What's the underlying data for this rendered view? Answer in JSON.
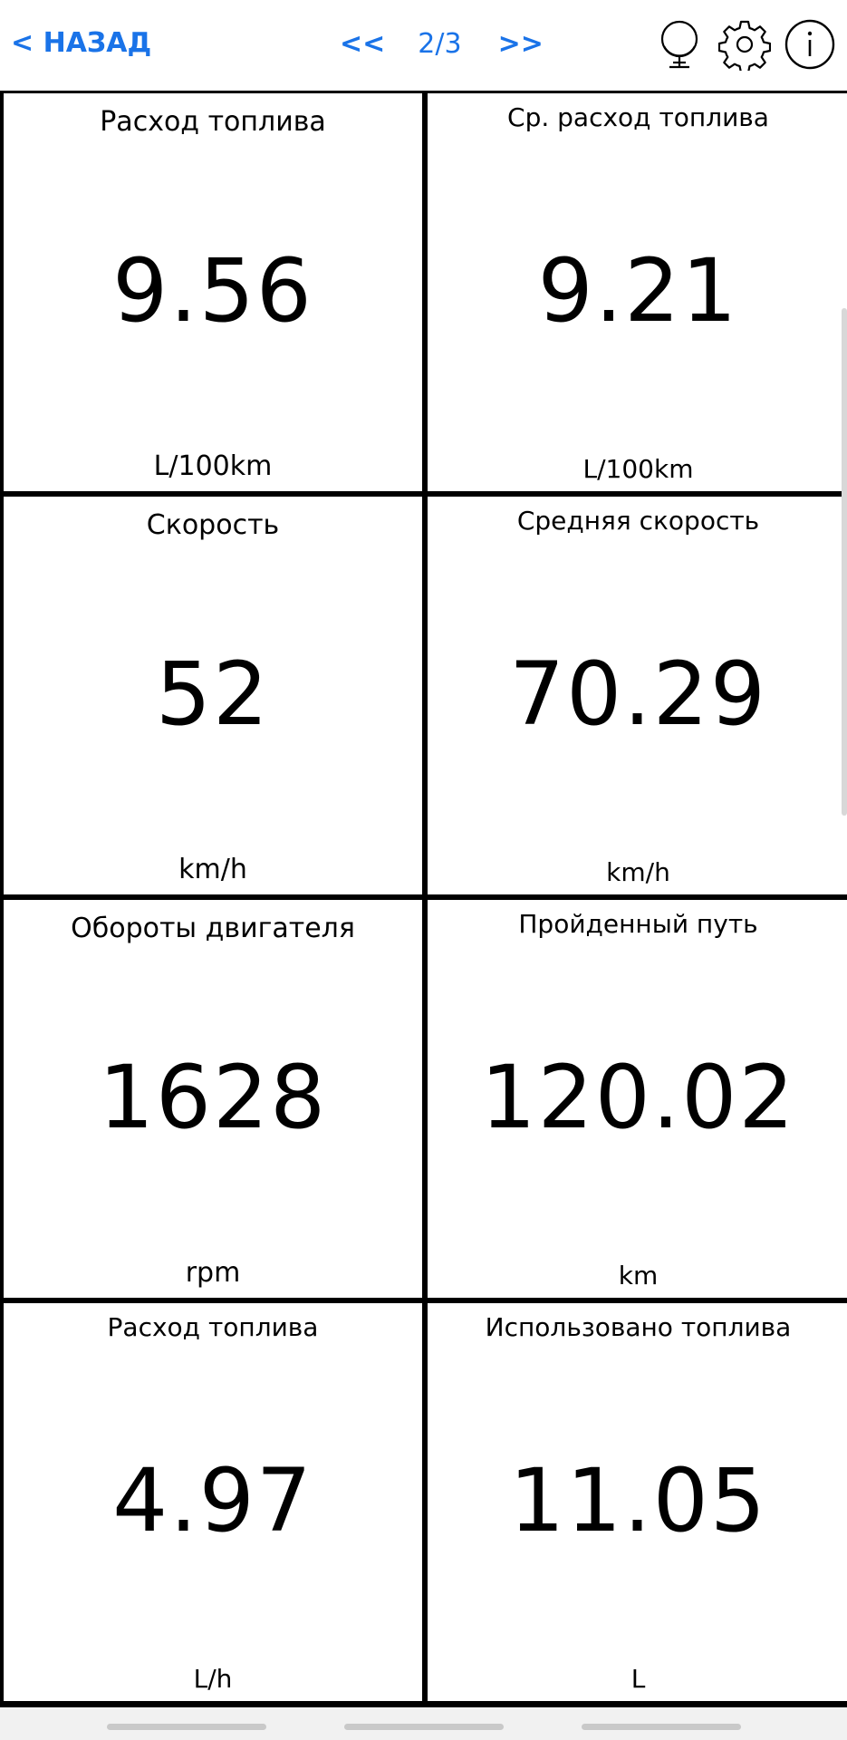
{
  "header": {
    "back_label": "< НАЗАД",
    "prev_label": "<<",
    "page_label": "2/3",
    "next_label": ">>",
    "icons": [
      "globe-icon",
      "gear-icon",
      "info-icon"
    ]
  },
  "tiles": [
    {
      "title": "Расход топлива",
      "value": "9.56",
      "unit": "L/100km"
    },
    {
      "title": "Ср. расход топлива",
      "value": "9.21",
      "unit": "L/100km"
    },
    {
      "title": "Скорость",
      "value": "52",
      "unit": "km/h"
    },
    {
      "title": "Средняя скорость",
      "value": "70.29",
      "unit": "km/h"
    },
    {
      "title": "Обороты двигателя",
      "value": "1628",
      "unit": "rpm"
    },
    {
      "title": "Пройденный путь",
      "value": "120.02",
      "unit": "km"
    },
    {
      "title": "Расход топлива",
      "value": "4.97",
      "unit": "L/h"
    },
    {
      "title": "Использовано топлива",
      "value": "11.05",
      "unit": "L"
    }
  ],
  "colors": {
    "accent": "#1a73e8",
    "grid_lines": "#000000",
    "tile_bg": "#ffffff"
  }
}
